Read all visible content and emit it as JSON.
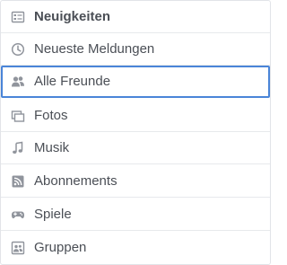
{
  "menu": {
    "items": [
      {
        "label": "Neuigkeiten",
        "icon": "newsfeed-icon",
        "bold": true
      },
      {
        "label": "Neueste Meldungen",
        "icon": "clock-icon"
      },
      {
        "label": "Alle Freunde",
        "icon": "friends-icon",
        "active": true
      },
      {
        "label": "Fotos",
        "icon": "photos-icon"
      },
      {
        "label": "Musik",
        "icon": "music-note-icon"
      },
      {
        "label": "Abonnements",
        "icon": "rss-feed-icon"
      },
      {
        "label": "Spiele",
        "icon": "gamepad-icon"
      },
      {
        "label": "Gruppen",
        "icon": "groups-icon"
      }
    ]
  },
  "colors": {
    "text": "#4b4f56",
    "icon": "#90949c",
    "active_border": "#4a85d8",
    "divider": "#e7e9ec"
  }
}
